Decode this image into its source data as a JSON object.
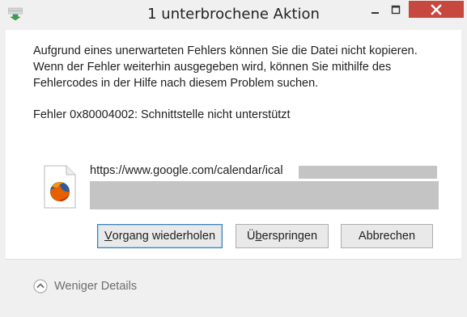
{
  "window": {
    "title": "1 unterbrochene Aktion"
  },
  "message": {
    "text": "Aufgrund eines unerwarteten Fehlers können Sie die Datei nicht kopieren.\nWenn der Fehler weiterhin ausgegeben wird, können Sie mithilfe des\nFehlercodes in der Hilfe nach diesem Problem suchen.",
    "error": "Fehler 0x80004002: Schnittstelle nicht unterstützt"
  },
  "file": {
    "url": "https://www.google.com/calendar/ical",
    "icon": "firefox-document-icon"
  },
  "buttons": {
    "retry": {
      "prefix": "",
      "mnemonic": "V",
      "suffix": "organg wiederholen"
    },
    "skip": {
      "prefix": "Ü",
      "mnemonic": "b",
      "suffix": "erspringen"
    },
    "cancel": "Abbrechen"
  },
  "footer": {
    "details_label": "Weniger Details"
  },
  "colors": {
    "close_button": "#c7483f",
    "default_button_border": "#3c7fb1"
  }
}
